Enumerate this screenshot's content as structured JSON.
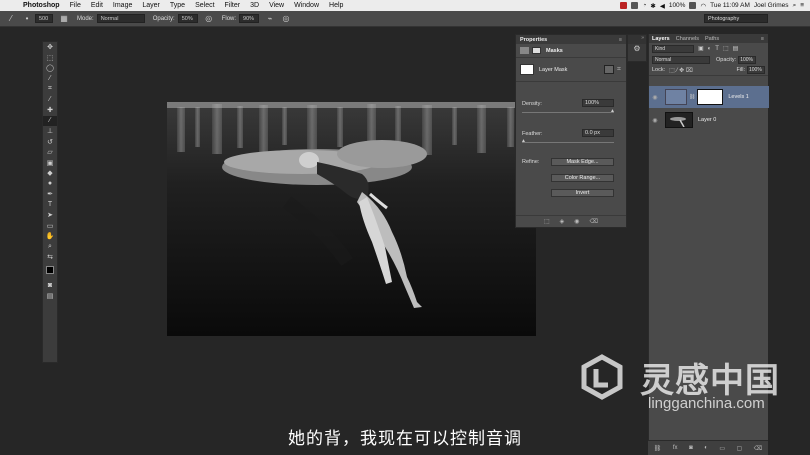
{
  "menubar": {
    "app_name": "Photoshop",
    "items": [
      "File",
      "Edit",
      "Image",
      "Layer",
      "Type",
      "Select",
      "Filter",
      "3D",
      "View",
      "Window",
      "Help"
    ],
    "battery": "100%",
    "clock": "Tue 11:09 AM",
    "user": "Joel Grimes"
  },
  "options_bar": {
    "brush_size": "500",
    "mode_label": "Mode:",
    "mode_value": "Normal",
    "opacity_label": "Opacity:",
    "opacity_value": "50%",
    "flow_label": "Flow:",
    "flow_value": "90%",
    "workspace": "Photography"
  },
  "properties": {
    "tab": "Properties",
    "title": "Masks",
    "mask_label": "Layer Mask",
    "density_label": "Density:",
    "density_value": "100%",
    "feather_label": "Feather:",
    "feather_value": "0.0 px",
    "refine_label": "Refine:",
    "buttons": [
      "Mask Edge...",
      "Color Range...",
      "Invert"
    ]
  },
  "layers": {
    "tabs": [
      "Layers",
      "Channels",
      "Paths"
    ],
    "filter_kind": "Kind",
    "blend_mode": "Normal",
    "opacity_label": "Opacity:",
    "opacity_value": "100%",
    "lock_label": "Lock:",
    "fill_label": "Fill:",
    "fill_value": "100%",
    "items": [
      {
        "name": "Levels 1"
      },
      {
        "name": "Layer 0"
      }
    ]
  },
  "subtitle": "她的背，我现在可以控制音调",
  "watermark": {
    "brand": "灵感中国",
    "url": "lingganchina.com"
  },
  "colors": {
    "selected_layer": "#5c6f8f",
    "panel": "#4a4a4a",
    "workspace_bg": "#262626"
  }
}
